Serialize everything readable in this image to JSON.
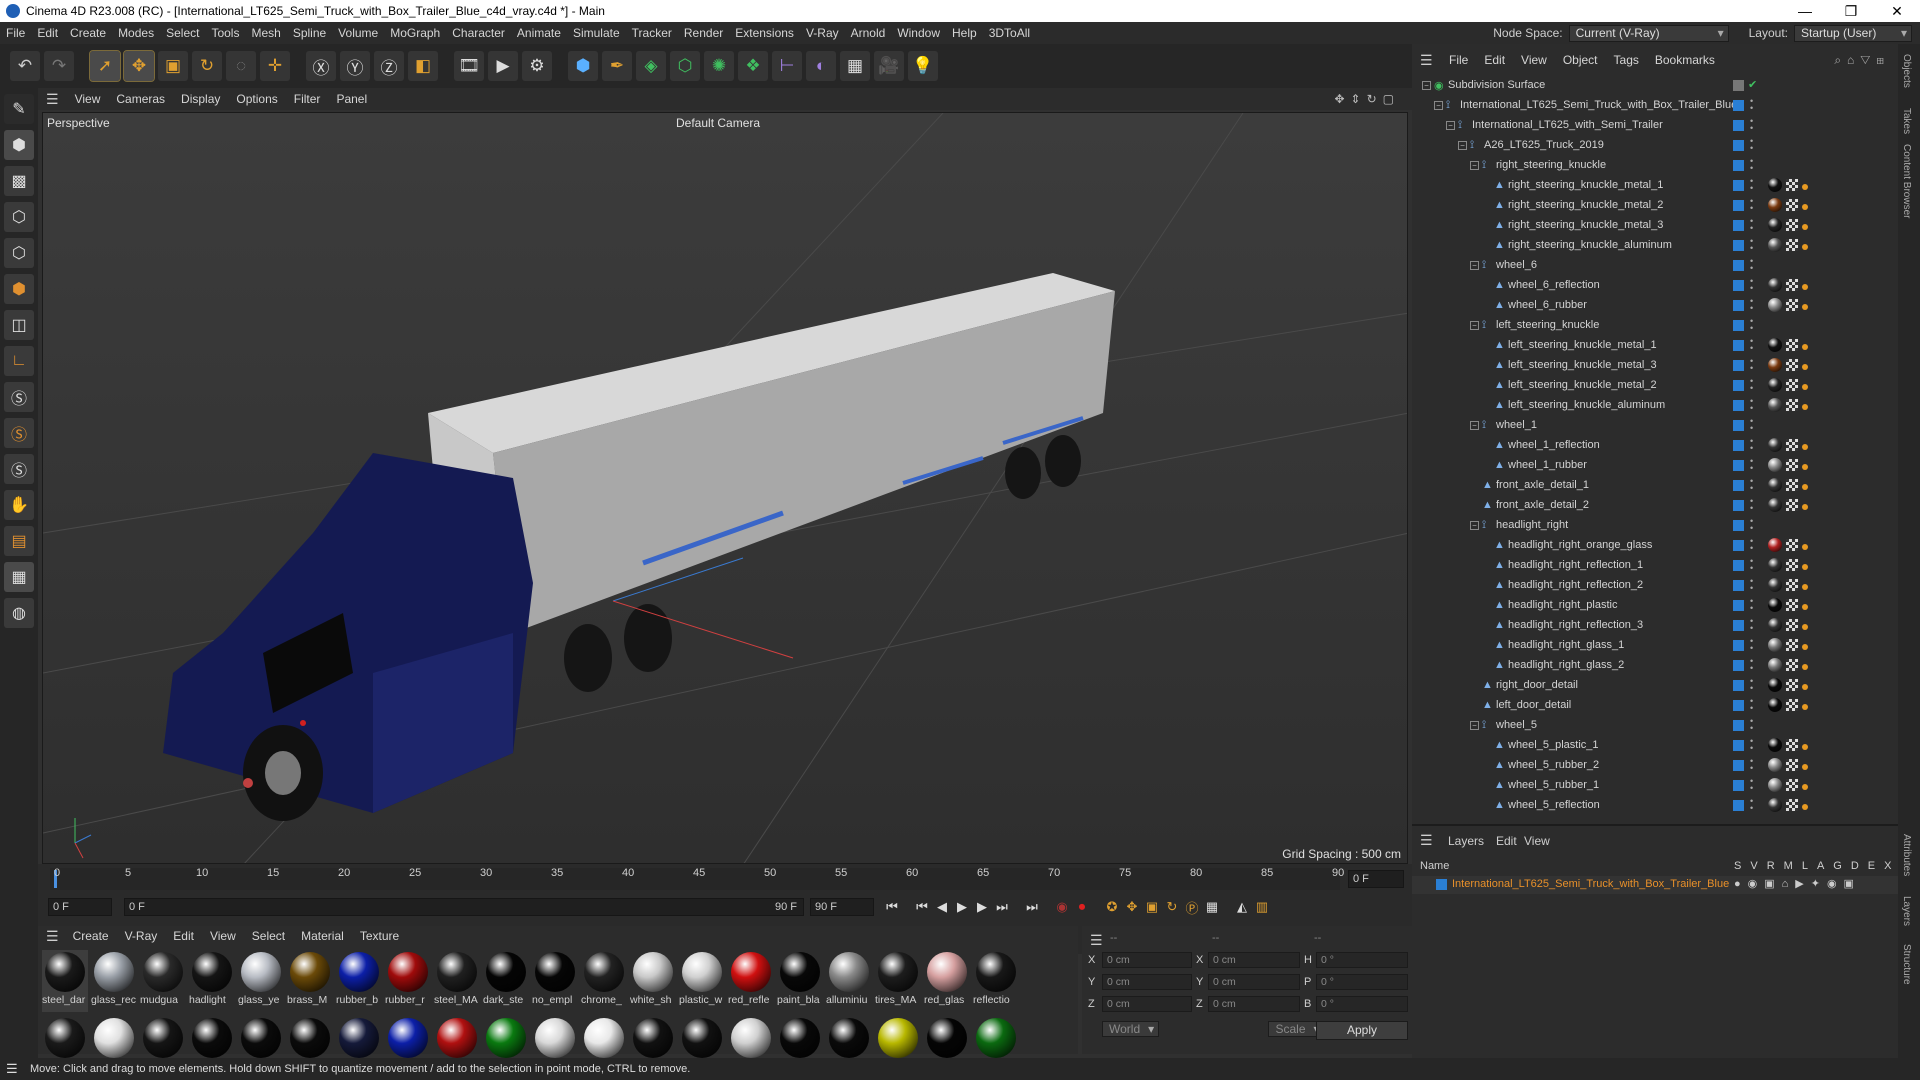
{
  "window": {
    "title": "Cinema 4D R23.008 (RC) - [International_LT625_Semi_Truck_with_Box_Trailer_Blue_c4d_vray.c4d *] - Main",
    "minimize": "—",
    "maximize": "❐",
    "close": "✕"
  },
  "menubar": {
    "items": [
      "File",
      "Edit",
      "Create",
      "Modes",
      "Select",
      "Tools",
      "Mesh",
      "Spline",
      "Volume",
      "MoGraph",
      "Character",
      "Animate",
      "Simulate",
      "Tracker",
      "Render",
      "Extensions",
      "V-Ray",
      "Arnold",
      "Window",
      "Help",
      "3DToAll"
    ],
    "node_space_label": "Node Space:",
    "node_space_value": "Current (V-Ray)",
    "layout_label": "Layout:",
    "layout_value": "Startup (User)"
  },
  "viewport": {
    "menu": [
      "View",
      "Cameras",
      "Display",
      "Options",
      "Filter",
      "Panel"
    ],
    "label": "Perspective",
    "camera": "Default Camera",
    "grid_spacing": "Grid Spacing : 500 cm"
  },
  "timeline": {
    "ticks": [
      "0",
      "5",
      "10",
      "15",
      "20",
      "25",
      "30",
      "35",
      "40",
      "45",
      "50",
      "55",
      "60",
      "65",
      "70",
      "75",
      "80",
      "85",
      "90"
    ],
    "end_frame_display": "0 F",
    "start_field": "0 F",
    "range_start": "0 F",
    "range_end": "90 F",
    "end_field": "90 F"
  },
  "materials": {
    "menu": [
      "Create",
      "V-Ray",
      "Edit",
      "View",
      "Select",
      "Material",
      "Texture"
    ],
    "row1": [
      {
        "name": "steel_dar",
        "color": "#1a1a1a"
      },
      {
        "name": "glass_rec",
        "color": "#9aa0a8"
      },
      {
        "name": "mudgua",
        "color": "#2a2a2a"
      },
      {
        "name": "hadlight",
        "color": "#151515"
      },
      {
        "name": "glass_ye",
        "color": "#b8bcc4"
      },
      {
        "name": "brass_M",
        "color": "#6b4a08"
      },
      {
        "name": "rubber_b",
        "color": "#0c1fa8"
      },
      {
        "name": "rubber_r",
        "color": "#a00b0b"
      },
      {
        "name": "steel_MA",
        "color": "#202020"
      },
      {
        "name": "dark_ste",
        "color": "#050505"
      },
      {
        "name": "no_empl",
        "color": "#060606"
      },
      {
        "name": "chrome_",
        "color": "#222"
      },
      {
        "name": "white_sh",
        "color": "#c9c9c9"
      },
      {
        "name": "plastic_w",
        "color": "#d0d0d0"
      },
      {
        "name": "red_refle",
        "color": "#d01010"
      },
      {
        "name": "paint_bla",
        "color": "#080808"
      },
      {
        "name": "alluminiu",
        "color": "#8a8a8a"
      },
      {
        "name": "tires_MA",
        "color": "#1d1d1d"
      },
      {
        "name": "red_glas",
        "color": "#d6a0a0"
      },
      {
        "name": "reflectio",
        "color": "#181818"
      }
    ],
    "row2": [
      "#1a1a1a",
      "#e0e0e0",
      "#151515",
      "#0b0b0b",
      "#0b0b0b",
      "#0b0b0b",
      "#151a3a",
      "#0c1fa8",
      "#b01010",
      "#0a7a10",
      "#d8d8d8",
      "#e8e8e8",
      "#111",
      "#111",
      "#d0d0d0",
      "#080808",
      "#0a0a0a",
      "#b8b800",
      "#050505",
      "#0b6a10"
    ]
  },
  "coords": {
    "header": [
      "--",
      "--",
      "--"
    ],
    "rows": [
      {
        "a": "X",
        "av": "0 cm",
        "b": "X",
        "bv": "0 cm",
        "c": "H",
        "cv": "0 °"
      },
      {
        "a": "Y",
        "av": "0 cm",
        "b": "Y",
        "bv": "0 cm",
        "c": "P",
        "cv": "0 °"
      },
      {
        "a": "Z",
        "av": "0 cm",
        "b": "Z",
        "bv": "0 cm",
        "c": "B",
        "cv": "0 °"
      }
    ],
    "mode1": "World",
    "mode2": "Scale",
    "apply": "Apply"
  },
  "objects": {
    "menu": [
      "File",
      "Edit",
      "View",
      "Object",
      "Tags",
      "Bookmarks"
    ],
    "tree": [
      {
        "name": "Subdivision Surface",
        "depth": 0,
        "exp": true,
        "tags": [],
        "top": true
      },
      {
        "name": "International_LT625_Semi_Truck_with_Box_Trailer_Blue",
        "depth": 1,
        "exp": true,
        "tags": []
      },
      {
        "name": "International_LT625_with_Semi_Trailer",
        "depth": 2,
        "exp": true,
        "tags": []
      },
      {
        "name": "A26_LT625_Truck_2019",
        "depth": 3,
        "exp": true,
        "tags": []
      },
      {
        "name": "right_steering_knuckle",
        "depth": 4,
        "exp": true,
        "tags": []
      },
      {
        "name": "right_steering_knuckle_metal_1",
        "depth": 5,
        "exp": false,
        "tags": [
          "#111"
        ]
      },
      {
        "name": "right_steering_knuckle_metal_2",
        "depth": 5,
        "exp": false,
        "tags": [
          "#7a3a10"
        ]
      },
      {
        "name": "right_steering_knuckle_metal_3",
        "depth": 5,
        "exp": false,
        "tags": [
          "#222"
        ]
      },
      {
        "name": "right_steering_knuckle_aluminum",
        "depth": 5,
        "exp": false,
        "tags": [
          "#555"
        ]
      },
      {
        "name": "wheel_6",
        "depth": 4,
        "exp": true,
        "tags": []
      },
      {
        "name": "wheel_6_reflection",
        "depth": 5,
        "exp": false,
        "tags": [
          "#333"
        ]
      },
      {
        "name": "wheel_6_rubber",
        "depth": 5,
        "exp": false,
        "tags": [
          "#888"
        ]
      },
      {
        "name": "left_steering_knuckle",
        "depth": 4,
        "exp": true,
        "tags": []
      },
      {
        "name": "left_steering_knuckle_metal_1",
        "depth": 5,
        "exp": false,
        "tags": [
          "#111"
        ]
      },
      {
        "name": "left_steering_knuckle_metal_3",
        "depth": 5,
        "exp": false,
        "tags": [
          "#7a3a10"
        ]
      },
      {
        "name": "left_steering_knuckle_metal_2",
        "depth": 5,
        "exp": false,
        "tags": [
          "#222"
        ]
      },
      {
        "name": "left_steering_knuckle_aluminum",
        "depth": 5,
        "exp": false,
        "tags": [
          "#555"
        ]
      },
      {
        "name": "wheel_1",
        "depth": 4,
        "exp": true,
        "tags": []
      },
      {
        "name": "wheel_1_reflection",
        "depth": 5,
        "exp": false,
        "tags": [
          "#333"
        ]
      },
      {
        "name": "wheel_1_rubber",
        "depth": 5,
        "exp": false,
        "tags": [
          "#888"
        ]
      },
      {
        "name": "front_axle_detail_1",
        "depth": 4,
        "exp": false,
        "tags": [
          "#333"
        ]
      },
      {
        "name": "front_axle_detail_2",
        "depth": 4,
        "exp": false,
        "tags": [
          "#333"
        ]
      },
      {
        "name": "headlight_right",
        "depth": 4,
        "exp": true,
        "tags": []
      },
      {
        "name": "headlight_right_orange_glass",
        "depth": 5,
        "exp": false,
        "tags": [
          "#b02020"
        ]
      },
      {
        "name": "headlight_right_reflection_1",
        "depth": 5,
        "exp": false,
        "tags": [
          "#333"
        ]
      },
      {
        "name": "headlight_right_reflection_2",
        "depth": 5,
        "exp": false,
        "tags": [
          "#333"
        ]
      },
      {
        "name": "headlight_right_plastic",
        "depth": 5,
        "exp": false,
        "tags": [
          "#0a0a0a"
        ]
      },
      {
        "name": "headlight_right_reflection_3",
        "depth": 5,
        "exp": false,
        "tags": [
          "#333"
        ]
      },
      {
        "name": "headlight_right_glass_1",
        "depth": 5,
        "exp": false,
        "tags": [
          "#777"
        ]
      },
      {
        "name": "headlight_right_glass_2",
        "depth": 5,
        "exp": false,
        "tags": [
          "#777"
        ]
      },
      {
        "name": "right_door_detail",
        "depth": 4,
        "exp": false,
        "tags": [
          "#0a0a0a"
        ]
      },
      {
        "name": "left_door_detail",
        "depth": 4,
        "exp": false,
        "tags": [
          "#0a0a0a"
        ]
      },
      {
        "name": "wheel_5",
        "depth": 4,
        "exp": true,
        "tags": []
      },
      {
        "name": "wheel_5_plastic_1",
        "depth": 5,
        "exp": false,
        "tags": [
          "#0a0a0a"
        ]
      },
      {
        "name": "wheel_5_rubber_2",
        "depth": 5,
        "exp": false,
        "tags": [
          "#888"
        ]
      },
      {
        "name": "wheel_5_rubber_1",
        "depth": 5,
        "exp": false,
        "tags": [
          "#888"
        ]
      },
      {
        "name": "wheel_5_reflection",
        "depth": 5,
        "exp": false,
        "tags": [
          "#333"
        ]
      }
    ]
  },
  "layers": {
    "menu": [
      "Layers",
      "Edit",
      "View"
    ],
    "col_name": "Name",
    "cols": [
      "S",
      "V",
      "R",
      "M",
      "L",
      "A",
      "G",
      "D",
      "E",
      "X"
    ],
    "item": "International_LT625_Semi_Truck_with_Box_Trailer_Blue"
  },
  "right_tabs": [
    "Objects",
    "Takes",
    "Content Browser",
    "Attributes",
    "Layers",
    "Structure"
  ],
  "status": "Move: Click and drag to move elements. Hold down SHIFT to quantize movement / add to the selection in point mode, CTRL to remove."
}
